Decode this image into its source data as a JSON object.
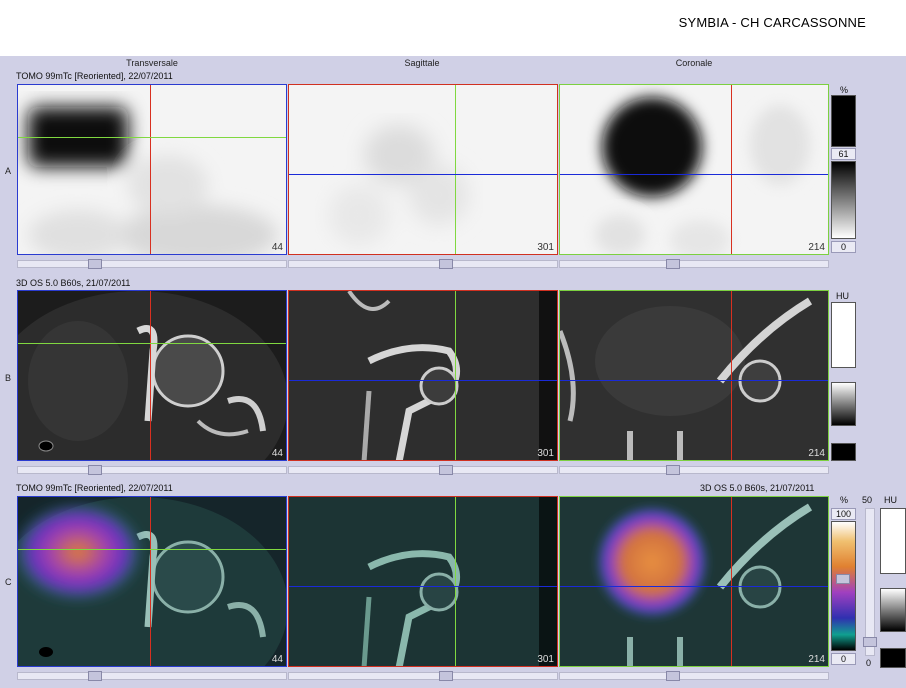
{
  "header": {
    "title": "SYMBIA - CH CARCASSONNE"
  },
  "columns": [
    "Transversale",
    "Sagittale",
    "Coronale"
  ],
  "rows": [
    {
      "letter": "A",
      "info": "TOMO 99mTc [Reoriented], 22/07/2011",
      "info_right": ""
    },
    {
      "letter": "B",
      "info": "3D  OS  5.0  B60s, 21/07/2011",
      "info_right": ""
    },
    {
      "letter": "C",
      "info": "TOMO 99mTc [Reoriented], 22/07/2011",
      "info_right": "3D  OS  5.0  B60s, 21/07/2011"
    }
  ],
  "slice_numbers": [
    "44",
    "301",
    "214"
  ],
  "colorbars": {
    "nm": {
      "unit": "%",
      "value": "61",
      "min": "0"
    },
    "ct": {
      "unit": "HU"
    },
    "fusion": {
      "unit": "%",
      "max": "100",
      "min": "0",
      "ct_unit": "HU",
      "ct_value": "50",
      "ct_min": "0"
    }
  },
  "colors": {
    "crosshair_x": "#d83020",
    "crosshair_y": "#80d840",
    "crosshair_z": "#1a2ad8",
    "background": "#d0d0e6"
  }
}
